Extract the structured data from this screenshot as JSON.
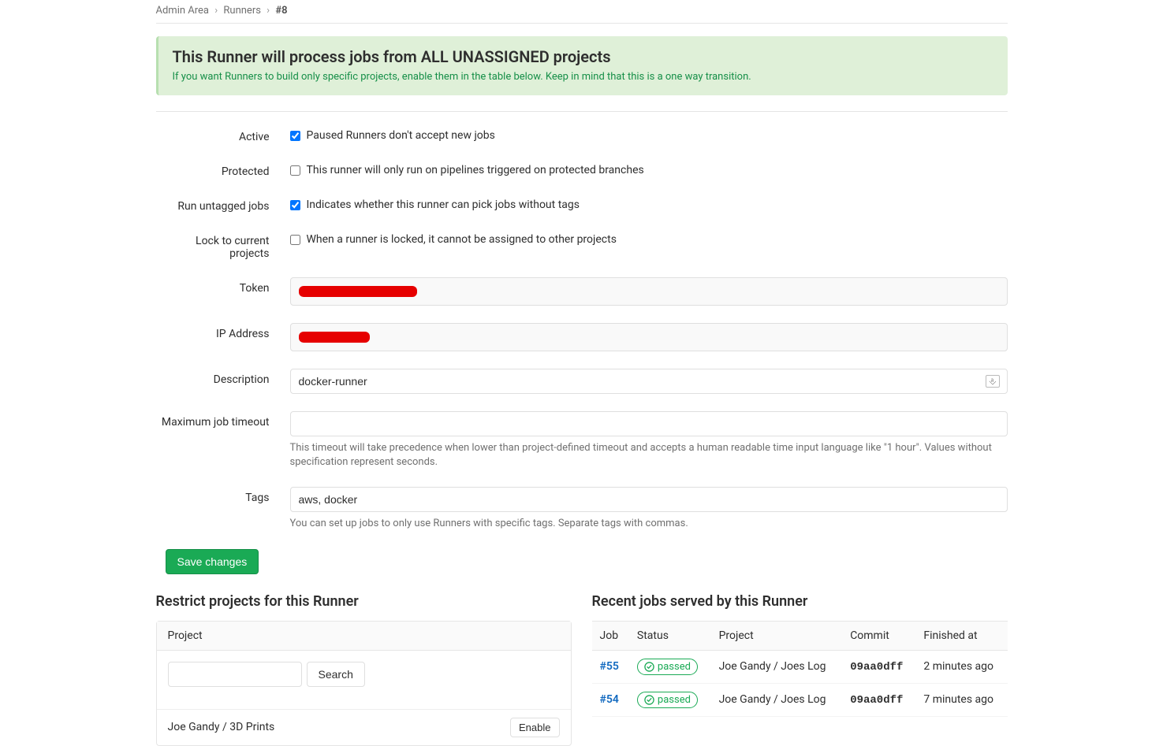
{
  "breadcrumb": {
    "root": "Admin Area",
    "mid": "Runners",
    "current": "#8"
  },
  "alert": {
    "title": "This Runner will process jobs from ALL UNASSIGNED projects",
    "body": "If you want Runners to build only specific projects, enable them in the table below. Keep in mind that this is a one way transition."
  },
  "form": {
    "active": {
      "label": "Active",
      "desc": "Paused Runners don't accept new jobs"
    },
    "protected": {
      "label": "Protected",
      "desc": "This runner will only run on pipelines triggered on protected branches"
    },
    "untagged": {
      "label": "Run untagged jobs",
      "desc": "Indicates whether this runner can pick jobs without tags"
    },
    "lock": {
      "label": "Lock to current projects",
      "desc": "When a runner is locked, it cannot be assigned to other projects"
    },
    "token": {
      "label": "Token"
    },
    "ip": {
      "label": "IP Address"
    },
    "description": {
      "label": "Description",
      "value": "docker-runner"
    },
    "timeout": {
      "label": "Maximum job timeout",
      "value": "",
      "help": "This timeout will take precedence when lower than project-defined timeout and accepts a human readable time input language like \"1 hour\". Values without specification represent seconds."
    },
    "tags": {
      "label": "Tags",
      "value": "aws, docker",
      "help": "You can set up jobs to only use Runners with specific tags. Separate tags with commas."
    },
    "save": "Save changes"
  },
  "restrict": {
    "heading": "Restrict projects for this Runner",
    "panel_header": "Project",
    "search_btn": "Search",
    "projects": [
      {
        "name": "Joe Gandy / 3D Prints",
        "action": "Enable"
      }
    ]
  },
  "jobs": {
    "heading": "Recent jobs served by this Runner",
    "cols": {
      "job": "Job",
      "status": "Status",
      "project": "Project",
      "commit": "Commit",
      "finished": "Finished at"
    },
    "rows": [
      {
        "job": "#55",
        "status": "passed",
        "project": "Joe Gandy / Joes Log",
        "commit": "09aa0dff",
        "finished": "2 minutes ago"
      },
      {
        "job": "#54",
        "status": "passed",
        "project": "Joe Gandy / Joes Log",
        "commit": "09aa0dff",
        "finished": "7 minutes ago"
      }
    ]
  }
}
